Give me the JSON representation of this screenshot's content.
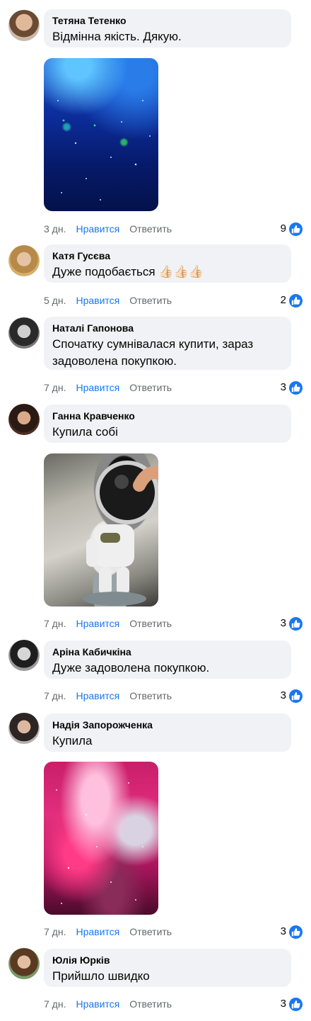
{
  "comments": [
    {
      "author": "Тетяна Тетенко",
      "text": "Відмінна якість. Дякую.",
      "time": "3 дн.",
      "like_label": "Нравится",
      "reply_label": "Ответить",
      "reactions": "9"
    },
    {
      "author": "Катя Гусєва",
      "text": "Дуже подобається",
      "emoji": "👍🏻👍🏻👍🏻",
      "time": "5 дн.",
      "like_label": "Нравится",
      "reply_label": "Ответить",
      "reactions": "2"
    },
    {
      "author": "Наталі Гапонова",
      "text": "Спочатку сумнівалася купити, зараз задоволена покупкою.",
      "time": "7 дн.",
      "like_label": "Нравится",
      "reply_label": "Ответить",
      "reactions": "3"
    },
    {
      "author": "Ганна Кравченко",
      "text": "Купила собі",
      "time": "7 дн.",
      "like_label": "Нравится",
      "reply_label": "Ответить",
      "reactions": "3"
    },
    {
      "author": "Аріна Кабичкіна",
      "text": "Дуже задоволена покупкою.",
      "time": "7 дн.",
      "like_label": "Нравится",
      "reply_label": "Ответить",
      "reactions": "3"
    },
    {
      "author": "Надія Запорожченка",
      "text": "Купила",
      "time": "7 дн.",
      "like_label": "Нравится",
      "reply_label": "Ответить",
      "reactions": "3"
    },
    {
      "author": "Юлія Юрків",
      "text": "Прийшло швидко",
      "time": "7 дн.",
      "like_label": "Нравится",
      "reply_label": "Ответить",
      "reactions": "3"
    }
  ],
  "colors": {
    "link": "#1877f2",
    "meta": "#65676b",
    "bubble": "#f0f2f5"
  }
}
